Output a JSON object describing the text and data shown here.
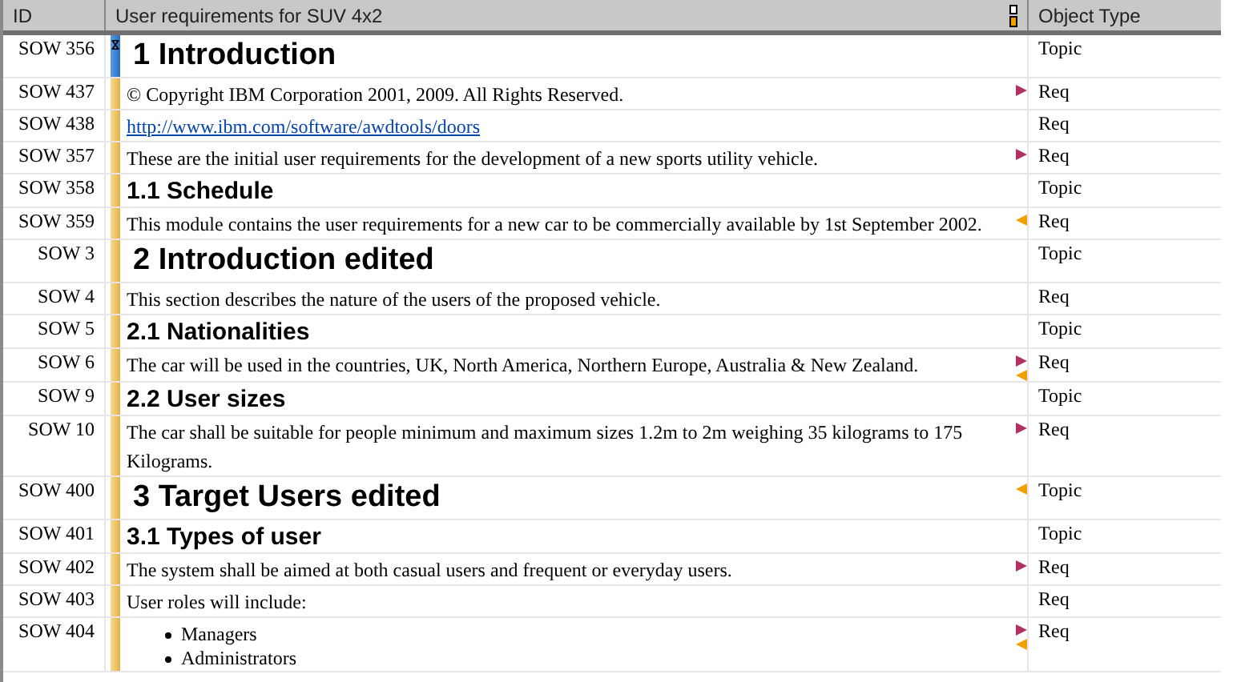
{
  "columns": [
    {
      "label": "ID"
    },
    {
      "label": "User requirements for SUV 4x2"
    },
    {
      "label": "Object Type"
    }
  ],
  "rows": [
    {
      "id": "SOW 356",
      "kind": "heading1",
      "text": "1 Introduction",
      "type": "Topic",
      "current": true,
      "link_out": false,
      "link_in": false
    },
    {
      "id": "SOW 437",
      "kind": "text",
      "text": "© Copyright IBM Corporation 2001, 2009. All Rights Reserved.",
      "type": "Req",
      "current": false,
      "link_out": true,
      "link_in": false
    },
    {
      "id": "SOW 438",
      "kind": "link",
      "text": "http://www.ibm.com/software/awdtools/doors",
      "type": "Req",
      "current": false,
      "link_out": false,
      "link_in": false
    },
    {
      "id": "SOW 357",
      "kind": "text",
      "text": "These are the initial user requirements for the development of a new sports utility vehicle.",
      "type": "Req",
      "current": false,
      "link_out": true,
      "link_in": false
    },
    {
      "id": "SOW 358",
      "kind": "heading2",
      "text": "1.1 Schedule",
      "type": "Topic",
      "current": false,
      "link_out": false,
      "link_in": false
    },
    {
      "id": "SOW 359",
      "kind": "text",
      "text": "This module contains the user requirements for a new car to be commercially available by 1st September 2002.",
      "type": "Req",
      "current": false,
      "link_out": false,
      "link_in": true
    },
    {
      "id": "SOW 3",
      "kind": "heading1",
      "text": "2 Introduction edited",
      "type": "Topic",
      "current": false,
      "link_out": false,
      "link_in": false
    },
    {
      "id": "SOW 4",
      "kind": "text",
      "text": "This section describes the nature of the users of the proposed vehicle.",
      "type": "Req",
      "current": false,
      "link_out": false,
      "link_in": false
    },
    {
      "id": "SOW 5",
      "kind": "heading2",
      "text": "2.1 Nationalities",
      "type": "Topic",
      "current": false,
      "link_out": false,
      "link_in": false
    },
    {
      "id": "SOW 6",
      "kind": "text",
      "text": "The car will be used in the countries, UK, North America, Northern Europe, Australia & New Zealand.",
      "type": "Req",
      "current": false,
      "link_out": true,
      "link_in": true
    },
    {
      "id": "SOW 9",
      "kind": "heading2",
      "text": "2.2 User sizes",
      "type": "Topic",
      "current": false,
      "link_out": false,
      "link_in": false
    },
    {
      "id": "SOW 10",
      "kind": "text",
      "text": "The car shall be suitable for people minimum and maximum sizes 1.2m to 2m weighing 35 kilograms to 175 Kilograms.",
      "type": "Req",
      "current": false,
      "link_out": true,
      "link_in": false
    },
    {
      "id": "SOW 400",
      "kind": "heading1",
      "text": "3 Target Users edited",
      "type": "Topic",
      "current": false,
      "link_out": false,
      "link_in": true
    },
    {
      "id": "SOW 401",
      "kind": "heading2",
      "text": "3.1 Types of user",
      "type": "Topic",
      "current": false,
      "link_out": false,
      "link_in": false
    },
    {
      "id": "SOW 402",
      "kind": "text",
      "text": "The system shall be aimed at both casual users and frequent or everyday users.",
      "type": "Req",
      "current": false,
      "link_out": true,
      "link_in": false
    },
    {
      "id": "SOW 403",
      "kind": "text",
      "text": "User roles will include:",
      "type": "Req",
      "current": false,
      "link_out": false,
      "link_in": false
    },
    {
      "id": "SOW 404",
      "kind": "bullets",
      "items": [
        "Managers",
        "Administrators"
      ],
      "type": "Req",
      "current": false,
      "link_out": true,
      "link_in": true
    }
  ]
}
